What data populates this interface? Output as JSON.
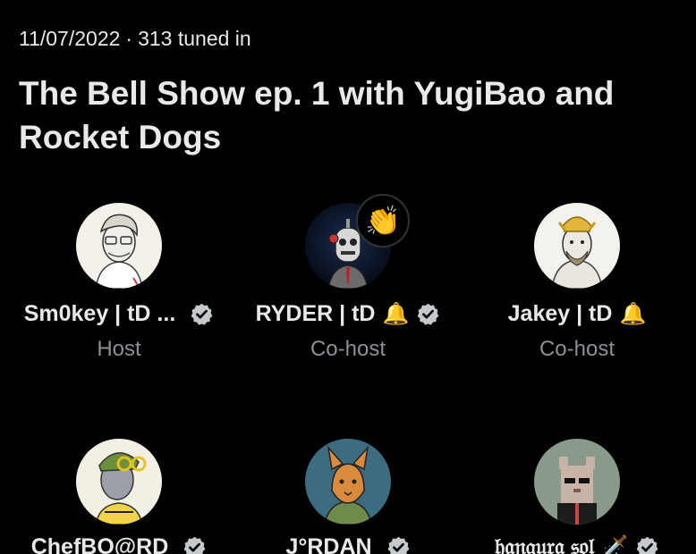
{
  "space": {
    "date": "11/07/2022",
    "separator": "·",
    "tuned_in": "313 tuned in",
    "title": "The Bell Show ep. 1 with YugiBao and Rocket Dogs"
  },
  "speakers": [
    {
      "name": "Sm0key | tD ...",
      "bell": "",
      "role": "Host",
      "verified": true
    },
    {
      "name": "RYDER | tD",
      "bell": "🔔",
      "role": "Co-host",
      "verified": true,
      "reaction": "👏"
    },
    {
      "name": "Jakey | tD",
      "bell": "🔔",
      "role": "Co-host",
      "verified": false
    },
    {
      "name": "ChefBO@RD",
      "bell": "",
      "role": "",
      "verified": true
    },
    {
      "name": "J°RDAN",
      "bell": "",
      "role": "",
      "verified": true
    },
    {
      "name": "𝔥𝔞𝔫𝔤𝔲𝔯𝔞 𝔰𝔬𝔩",
      "bell": "🗡️",
      "role": "",
      "verified": true
    }
  ],
  "colors": {
    "background": "#000000",
    "text": "#e7e9ea",
    "secondary": "#8b9096",
    "verified_badge": "#c4c9cc"
  }
}
